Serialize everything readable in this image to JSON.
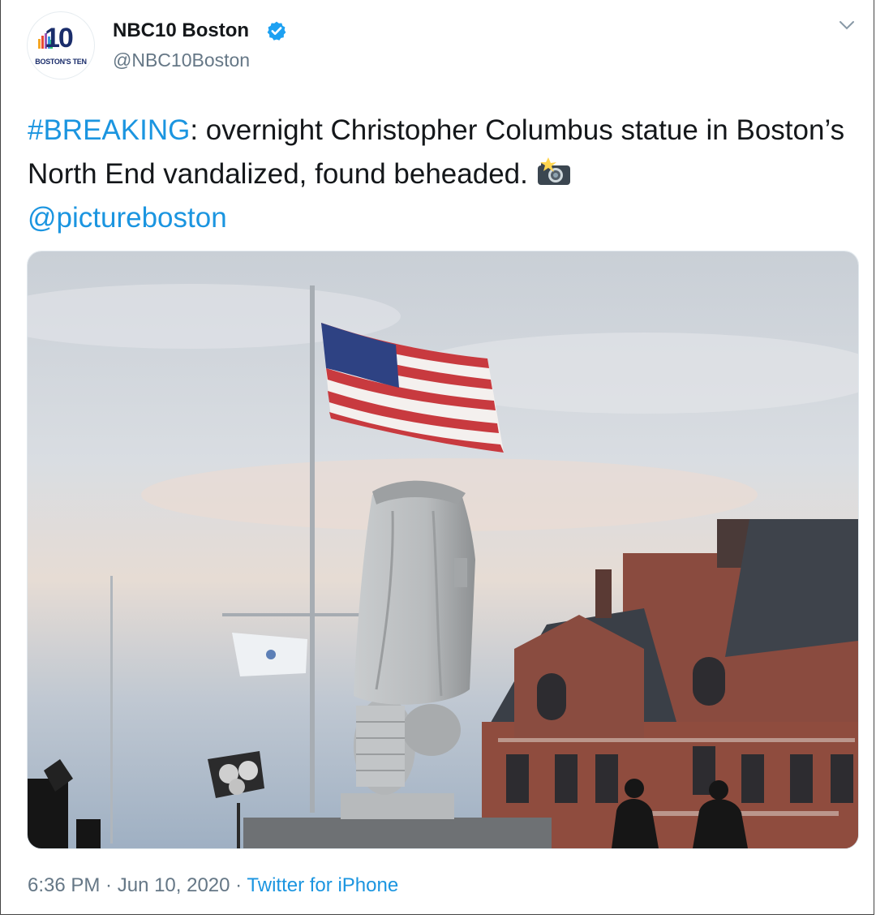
{
  "author": {
    "display_name": "NBC10 Boston",
    "handle": "@NBC10Boston",
    "avatar_text": "10",
    "avatar_tagline": "BOSTON'S TEN"
  },
  "tweet": {
    "hashtag": "#BREAKING",
    "text": ": overnight Christopher Columbus statue in Boston’s North End vandalized, found beheaded.",
    "mention": "@pictureboston"
  },
  "meta": {
    "time": "6:36 PM",
    "sep1": " · ",
    "date": "Jun 10, 2020",
    "sep2": " · ",
    "source": "Twitter for iPhone"
  },
  "icons": {
    "verified": "verified-badge-icon",
    "menu": "chevron-down-icon",
    "camera": "camera-flash-icon"
  },
  "colors": {
    "link": "#1b95e0",
    "text": "#14171a",
    "secondary": "#657786",
    "brand": "#1a2d6b"
  }
}
